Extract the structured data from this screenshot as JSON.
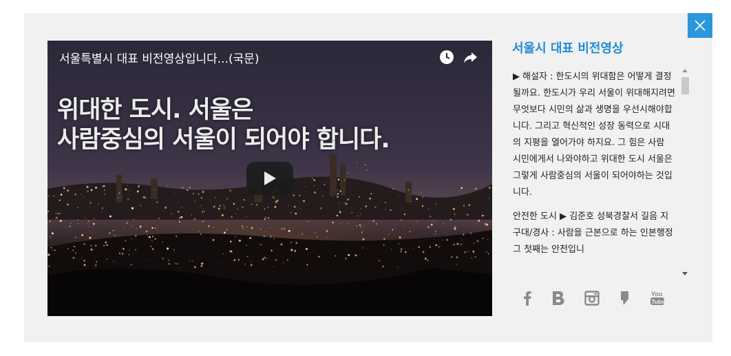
{
  "video": {
    "title": "서울특별시 대표 비전영상입니다...(국문)",
    "overlay_line1": "위대한 도시. 서울은",
    "overlay_line2": "사람중심의 서울이 되어야 합니다."
  },
  "sidebar": {
    "title": "서울시 대표 비전영상",
    "paragraphs": [
      "▶ 해설자 : 한도시의 위대함은 어떻게 결정될까요. 한도시가 우리 서울이 위대해지려면 무엇보다 시민의 삶과 생명을 우선시해야합니다. 그리고 혁신적인 성장 동력으로 시대의 지평을 열어가야 하지요. 그 힘은 사람 시민에게서 나와야하고 위대한 도시 서울은 그렇게 사람중심의 서울이 되어야하는 것입니다.",
      "안전한 도시 ▶ 김준호 성북경찰서 길음 지구대/경사 : 사람을 근본으로 하는 인본행정 그 첫째는 안전입니"
    ]
  },
  "social": [
    "facebook-icon",
    "blog-icon",
    "instagram-icon",
    "kakaostory-icon",
    "youtube-icon"
  ],
  "colors": {
    "accent": "#2b97dd",
    "title": "#1f8bd6",
    "panel": "#f1f1f1"
  }
}
